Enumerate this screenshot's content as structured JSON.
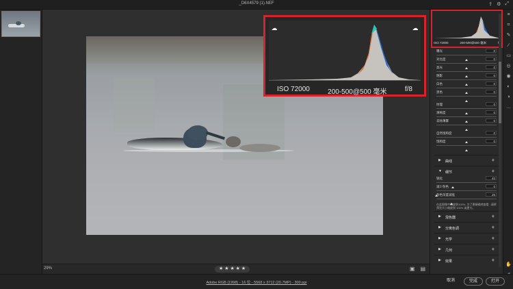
{
  "window": {
    "title": "_D6X4579 (1).NEF"
  },
  "histogram_zoom": {
    "iso": "ISO 72000",
    "lens": "200-500@500 毫米",
    "aperture": "f/8",
    "clip_shadow_icon": "shadow-clip-icon",
    "clip_highlight_icon": "highlight-clip-icon"
  },
  "mini_histogram": {
    "iso": "ISO 72000",
    "lens": "200-500@500 毫米",
    "aperture": "f/8"
  },
  "basic_sliders": [
    {
      "label": "曝光",
      "value": "0",
      "knob": 0.5
    },
    {
      "label": "对比度",
      "value": "0",
      "knob": 0.5
    },
    {
      "label": "高光",
      "value": "0",
      "knob": 0.5
    },
    {
      "label": "阴影",
      "value": "0",
      "knob": 0.5
    },
    {
      "label": "白色",
      "value": "0",
      "knob": 0.5
    },
    {
      "label": "黑色",
      "value": "0",
      "knob": 0.5
    }
  ],
  "presence_sliders": [
    {
      "label": "纹理",
      "value": "0",
      "knob": 0.5
    },
    {
      "label": "清晰度",
      "value": "0",
      "knob": 0.5
    },
    {
      "label": "去除薄雾",
      "value": "0",
      "knob": 0.5
    }
  ],
  "color_sliders": [
    {
      "label": "自然饱和度",
      "value": "0",
      "knob": 0.5
    },
    {
      "label": "饱和度",
      "value": "0",
      "knob": 0.5
    }
  ],
  "sections": {
    "curve": "曲线",
    "detail": "细节",
    "mixer": "混色器",
    "split": "分离色调",
    "optics": "光学",
    "geometry": "几何",
    "effects": "效果"
  },
  "detail_sliders": [
    {
      "label": "锐化",
      "value": "40",
      "knob": 0.27
    },
    {
      "label": "减少杂色",
      "value": "0",
      "knob": 0.0
    },
    {
      "label": "杂色深度减低",
      "value": "25",
      "knob": 0.25
    }
  ],
  "detail_note": "在此图像中缩放到100%, 为了更精确地查看...请将预览大小缩放到 100% 或更大。",
  "bottom": {
    "zoom": "29%",
    "stars": "★ ★ ★ ★ ★"
  },
  "footer": {
    "file_info": "Adobe RGB (1998) - 16 位 - 5568 x 3712 (20.7MP) - 300 ppi",
    "cancel": "取消",
    "done": "完成",
    "open": "打开"
  },
  "tools": [
    "edit-icon",
    "crop-icon",
    "heal-icon",
    "brush-icon",
    "gradient-icon",
    "radial-icon",
    "redeye-icon",
    "presets-icon",
    "snapshot-icon",
    "more-icon"
  ],
  "colors": {
    "accent_red": "#d8232a"
  }
}
